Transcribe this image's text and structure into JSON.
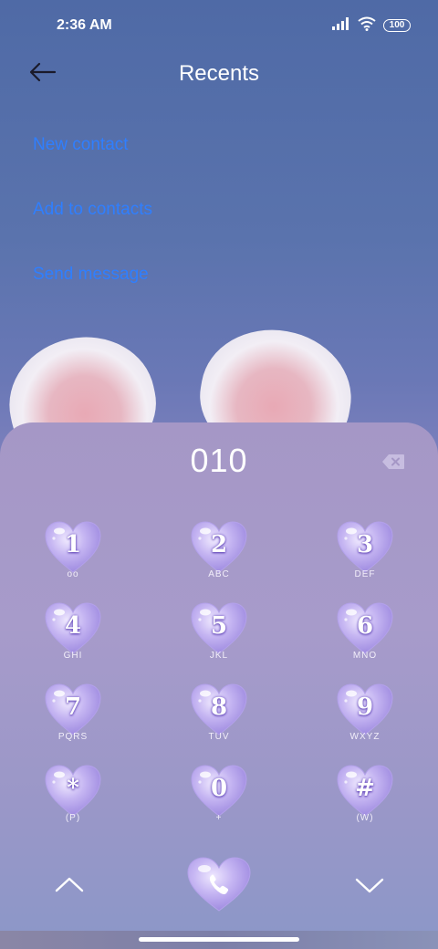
{
  "status_bar": {
    "time": "2:36 AM",
    "battery": "100"
  },
  "header": {
    "title": "Recents"
  },
  "actions": [
    {
      "label": "New contact"
    },
    {
      "label": "Add to contacts"
    },
    {
      "label": "Send message"
    }
  ],
  "dialer": {
    "number": "010",
    "keys": [
      {
        "digit": "1",
        "sub": "oo"
      },
      {
        "digit": "2",
        "sub": "ABC"
      },
      {
        "digit": "3",
        "sub": "DEF"
      },
      {
        "digit": "4",
        "sub": "GHI"
      },
      {
        "digit": "5",
        "sub": "JKL"
      },
      {
        "digit": "6",
        "sub": "MNO"
      },
      {
        "digit": "7",
        "sub": "PQRS"
      },
      {
        "digit": "8",
        "sub": "TUV"
      },
      {
        "digit": "9",
        "sub": "WXYZ"
      },
      {
        "digit": "*",
        "sub": "(P)"
      },
      {
        "digit": "0",
        "sub": "+"
      },
      {
        "digit": "#",
        "sub": "(W)"
      }
    ]
  },
  "icons": {
    "back": "arrow-left-icon",
    "backspace": "backspace-icon",
    "call": "phone-icon",
    "collapse": "chevron-up-icon",
    "expand": "chevron-down-icon",
    "signal": "signal-icon",
    "wifi": "wifi-icon"
  },
  "colors": {
    "link": "#2f7fff",
    "heart": "#b9a8f0",
    "panel": "#a597c6"
  }
}
